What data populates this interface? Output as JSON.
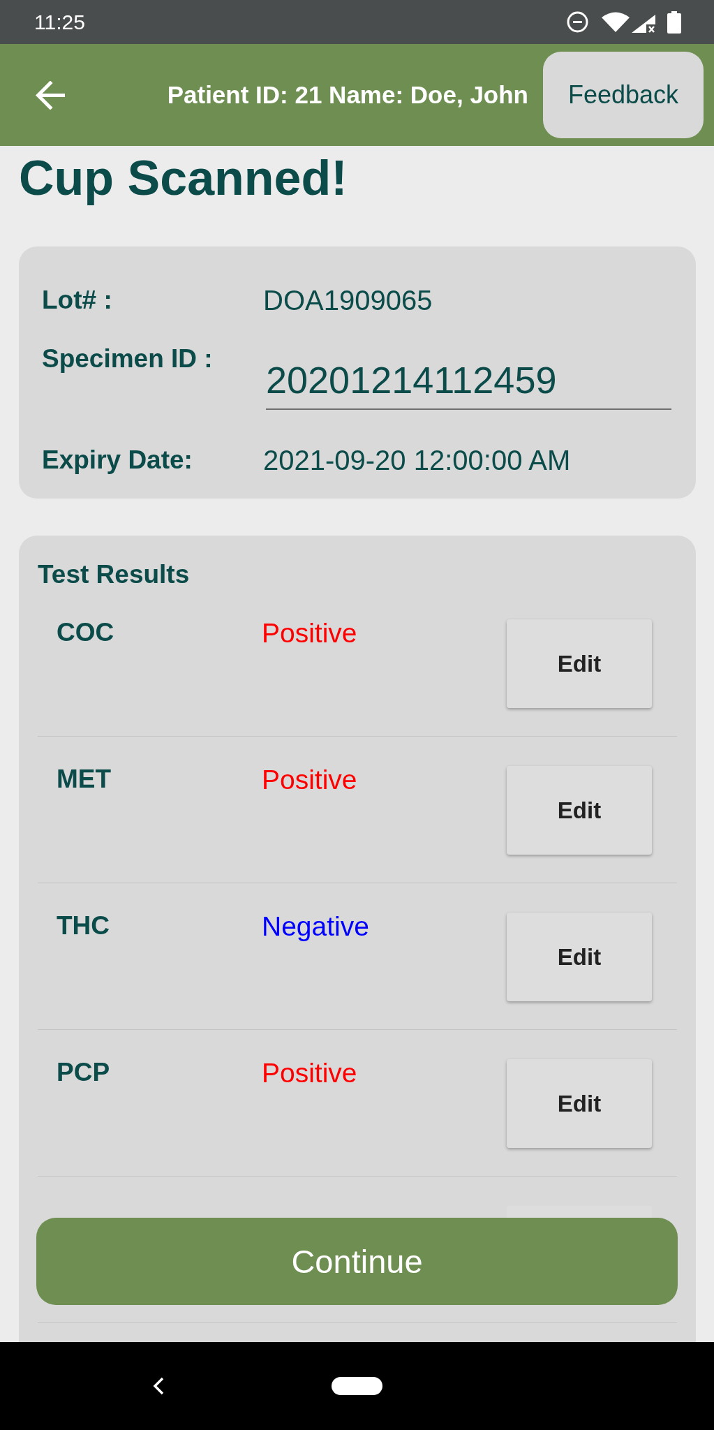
{
  "status_bar": {
    "time": "11:25"
  },
  "header": {
    "title": "Patient ID: 21 Name: Doe, John",
    "feedback_button": "Feedback"
  },
  "heading": "Cup Scanned!",
  "specimen": {
    "fields": [
      {
        "kind": "text",
        "label": "Lot# :",
        "value": "DOA1909065"
      },
      {
        "kind": "input",
        "label": "Specimen ID :",
        "value": "20201214112459"
      },
      {
        "kind": "text",
        "label": "Expiry Date:",
        "value": "2021-09-20 12:00:00 AM"
      }
    ]
  },
  "test_results": {
    "title": "Test Results",
    "rows": [
      {
        "name": "COC",
        "result": "Positive",
        "color": "#ff0000",
        "button": "Edit",
        "covered": false
      },
      {
        "name": "MET",
        "result": "Positive",
        "color": "#ff0000",
        "button": "Edit",
        "covered": false
      },
      {
        "name": "THC",
        "result": "Negative",
        "color": "#0000ff",
        "button": "Edit",
        "covered": false
      },
      {
        "name": "PCP",
        "result": "Positive",
        "color": "#ff0000",
        "button": "Edit",
        "covered": false
      },
      {
        "covered": true
      }
    ]
  },
  "continue_button": "Continue"
}
